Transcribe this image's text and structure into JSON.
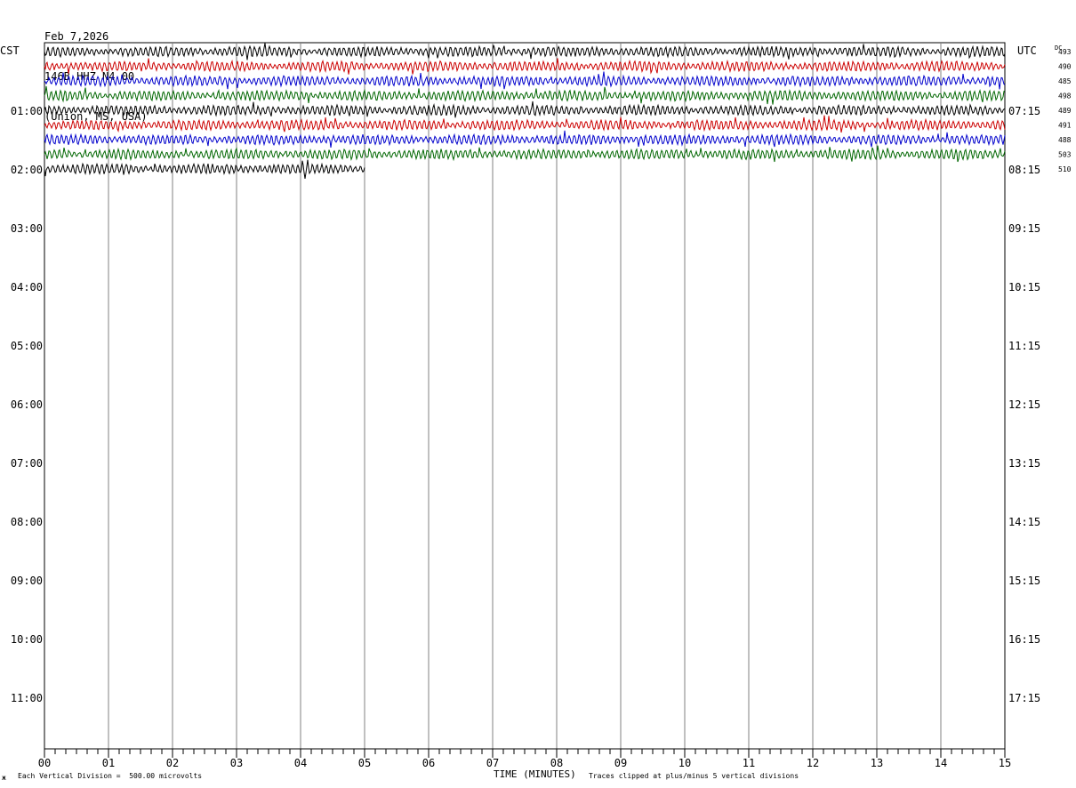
{
  "header": {
    "date": "Feb 7,2026",
    "station": "146B HHZ N4 00",
    "location": "(Union, MS, USA)"
  },
  "left_zone": "CST",
  "right_zone": "UTC",
  "dc_label": "DC",
  "footer": {
    "scale_note": "Each Vertical Division =  500.00 microvolts",
    "clip_note": "Traces clipped at plus/minus 5 vertical divisions",
    "corner_mark": "ж"
  },
  "colors": {
    "black": "#000000",
    "red": "#cc0000",
    "blue": "#0000cc",
    "green": "#006600",
    "grid": "#808080"
  },
  "chart_data": {
    "type": "line",
    "title": "",
    "xlabel": "TIME (MINUTES)",
    "ylabel": "",
    "xlim": [
      0,
      15
    ],
    "x_ticks": [
      "00",
      "01",
      "02",
      "03",
      "04",
      "05",
      "06",
      "07",
      "08",
      "09",
      "10",
      "11",
      "12",
      "13",
      "14",
      "15"
    ],
    "left_time_labels": [
      "01:00",
      "02:00",
      "03:00",
      "04:00",
      "05:00",
      "06:00",
      "07:00",
      "08:00",
      "09:00",
      "10:00",
      "11:00"
    ],
    "right_time_labels": [
      "07:15",
      "08:15",
      "09:15",
      "10:15",
      "11:15",
      "12:15",
      "13:15",
      "14:15",
      "15:15",
      "16:15",
      "17:15"
    ],
    "trace_color_cycle": [
      "black",
      "red",
      "blue",
      "green"
    ],
    "traces": [
      {
        "dc": "493",
        "minutes": 15
      },
      {
        "dc": "490",
        "minutes": 15
      },
      {
        "dc": "485",
        "minutes": 15
      },
      {
        "dc": "498",
        "minutes": 15
      },
      {
        "dc": "489",
        "minutes": 15
      },
      {
        "dc": "491",
        "minutes": 15
      },
      {
        "dc": "488",
        "minutes": 15
      },
      {
        "dc": "503",
        "minutes": 15
      },
      {
        "dc": "510",
        "minutes": 5
      }
    ],
    "grid": true
  }
}
